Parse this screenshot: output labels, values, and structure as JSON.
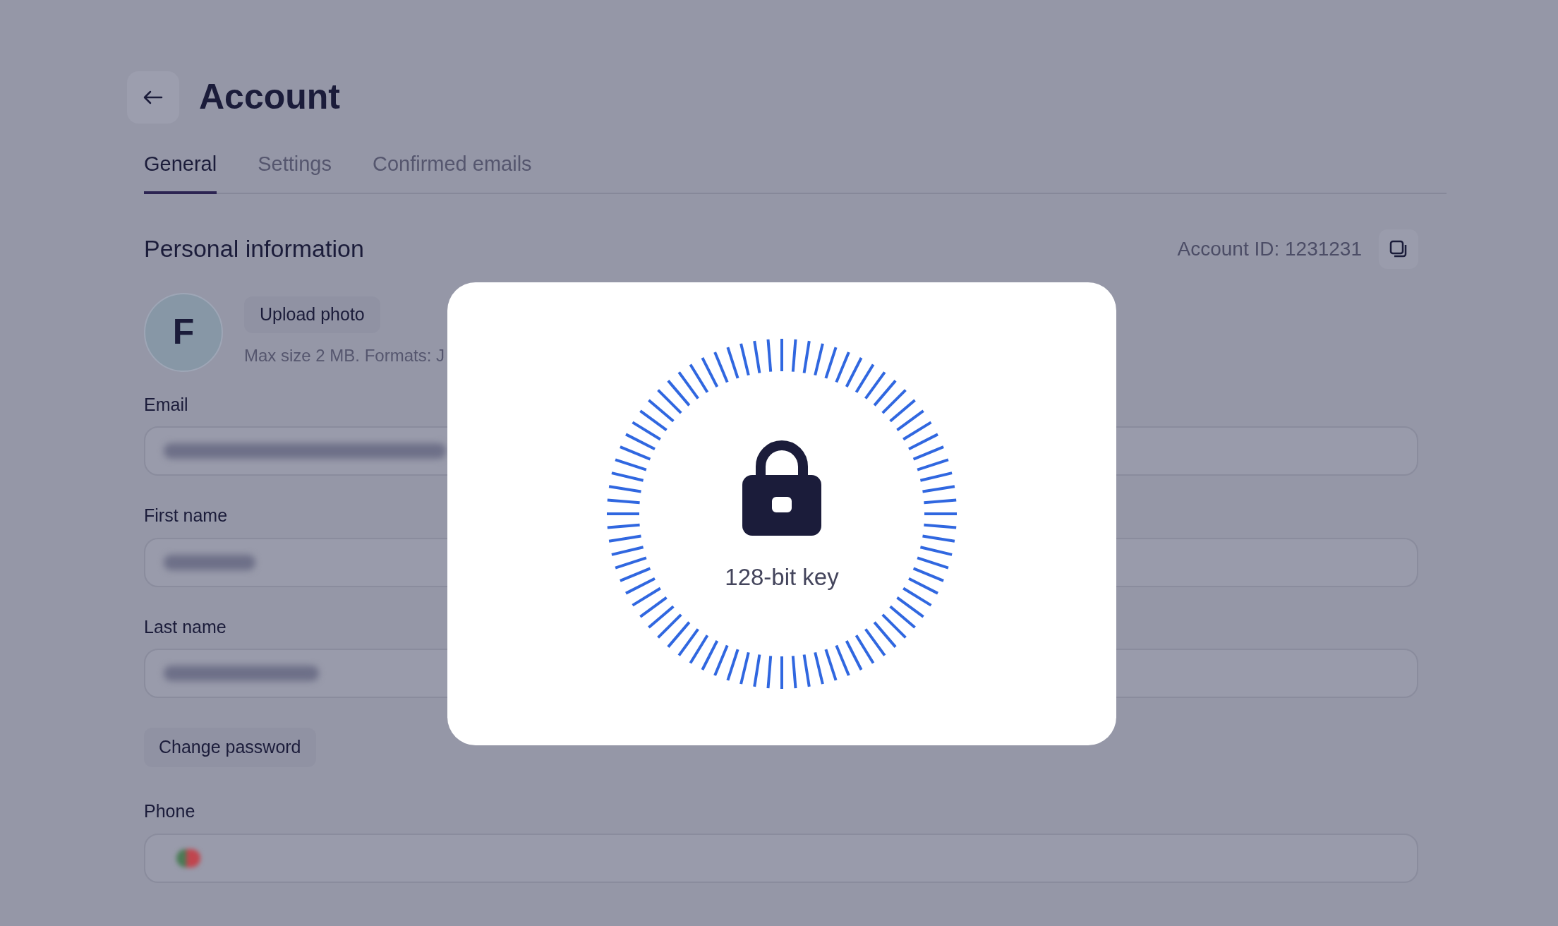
{
  "header": {
    "title": "Account"
  },
  "tabs": [
    {
      "label": "General",
      "selected": true
    },
    {
      "label": "Settings",
      "selected": false
    },
    {
      "label": "Confirmed emails",
      "selected": false
    }
  ],
  "section": {
    "title": "Personal information",
    "account_id": "Account ID: 1231231"
  },
  "avatar": {
    "initial": "F"
  },
  "upload": {
    "button": "Upload photo",
    "hint": "Max size 2 MB. Formats: J"
  },
  "fields": [
    {
      "label": "Email",
      "kind": "blurred"
    },
    {
      "label": "First name",
      "kind": "blurred"
    },
    {
      "label": "Last name",
      "kind": "blurred"
    }
  ],
  "change_password": "Change password",
  "phone": {
    "label": "Phone"
  },
  "modal": {
    "caption": "128-bit key"
  }
}
